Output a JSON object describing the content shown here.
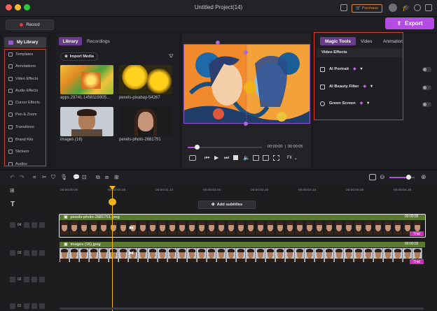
{
  "window": {
    "title": "Untitled Project(14)"
  },
  "titlebar": {
    "purchase_label": "Purchase"
  },
  "toolbar": {
    "record_label": "Record",
    "export_label": "Export"
  },
  "sidebar": {
    "header": "My Library",
    "items": [
      "Templates",
      "Annotations",
      "Video Effects",
      "Audio Effects",
      "Cursor Effects",
      "Pan & Zoom",
      "Transitions",
      "Brand Kits",
      "Stickers",
      "Audios"
    ]
  },
  "library": {
    "tabs": [
      "Library",
      "Recordings"
    ],
    "import_label": "Import Media",
    "media": [
      {
        "name": "apps.29741.1458119305..."
      },
      {
        "name": "pexels-pixabay-54267"
      },
      {
        "name": "images (16)"
      },
      {
        "name": "pexels-photo-2681751"
      }
    ]
  },
  "preview": {
    "time_current": "00:00:00",
    "time_total": "00:00:05",
    "fit_label": "Fit",
    "progress": 0.12
  },
  "right_panel": {
    "tabs": [
      "Magic Tools",
      "Video",
      "Animation"
    ],
    "section_title": "Video Effects",
    "effects": [
      {
        "name": "AI Portrait",
        "enabled": false
      },
      {
        "name": "AI Beauty Filter",
        "enabled": false
      },
      {
        "name": "Green Screen",
        "enabled": false
      }
    ]
  },
  "timeline": {
    "ruler": [
      "00:00:00.00",
      "00:00:00.20",
      "00:00:01.10",
      "00:00:02.00",
      "00:00:02.20",
      "00:00:03.10",
      "00:00:04.00",
      "00:00:04.20",
      "00:00:05.10"
    ],
    "add_subtitles_label": "Add subtitles",
    "tracks": [
      {
        "num": "04",
        "clip": "pexels-photo-2681751.jpeg",
        "clip_time": "00:00:05",
        "badge": "Trial"
      },
      {
        "num": "03",
        "clip": "images (16).jpeg",
        "clip_time": "00:00:05",
        "badge": "Trial"
      },
      {
        "num": "02"
      },
      {
        "num": "01"
      }
    ],
    "zoom_level": 0.75
  },
  "colors": {
    "accent": "#b44be3",
    "highlight": "#d93a2a",
    "playhead": "#f0b51a",
    "clip_green": "#5c7a2f",
    "trial": "#c038b5"
  }
}
